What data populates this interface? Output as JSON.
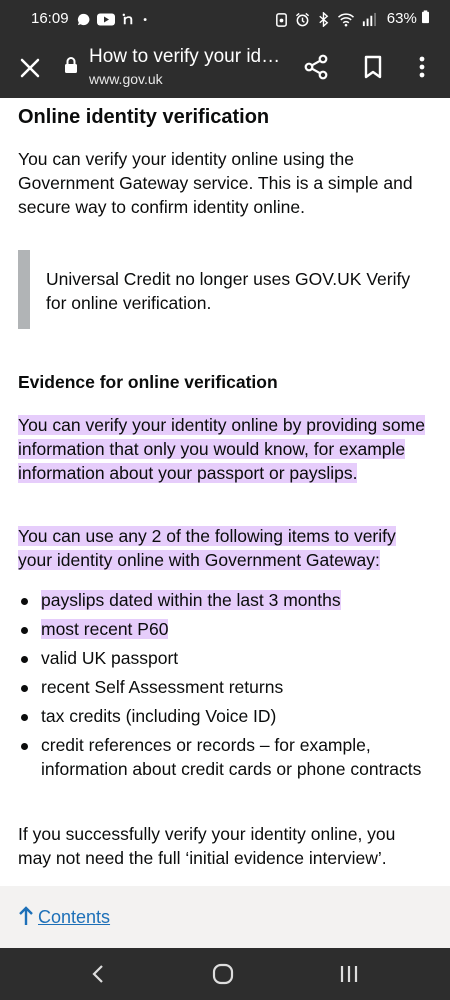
{
  "status_bar": {
    "time": "16:09",
    "left_icons": [
      "chat-bubble-icon",
      "youtube-icon",
      "app-n-icon",
      "dot-icon"
    ],
    "right_icons": [
      "alarm-lock-icon",
      "alarm-icon",
      "bluetooth-icon",
      "wifi-icon",
      "signal-icon"
    ],
    "battery": "63%"
  },
  "browser": {
    "title": "How to verify your identity",
    "url": "www.gov.uk"
  },
  "article": {
    "heading": "Online identity verification",
    "intro": "You can verify your identity online using the Government Gateway service. This is a simple and secure way to confirm identity online.",
    "inset": "Universal Credit no longer uses GOV.UK Verify for online verification.",
    "subheading": "Evidence for online verification",
    "para1": "You can verify your identity online by providing some information that only you would know, for example information about your passport or payslips.",
    "para2": "You can use any 2 of the following items to verify your identity online with Government Gateway:",
    "items": [
      "payslips dated within the last 3 months",
      "most recent P60",
      "valid UK passport",
      "recent Self Assessment returns",
      "tax credits (including Voice ID)",
      "credit references or records – for example, information about credit cards or phone contracts"
    ],
    "outro": "If you successfully verify your identity online, you may not need the full ‘initial evidence interview’."
  },
  "footer": {
    "contents_link": "Contents"
  },
  "colors": {
    "highlight": "#e6cdfb",
    "link": "#1d70b8",
    "bar": "#2d2d2d"
  }
}
